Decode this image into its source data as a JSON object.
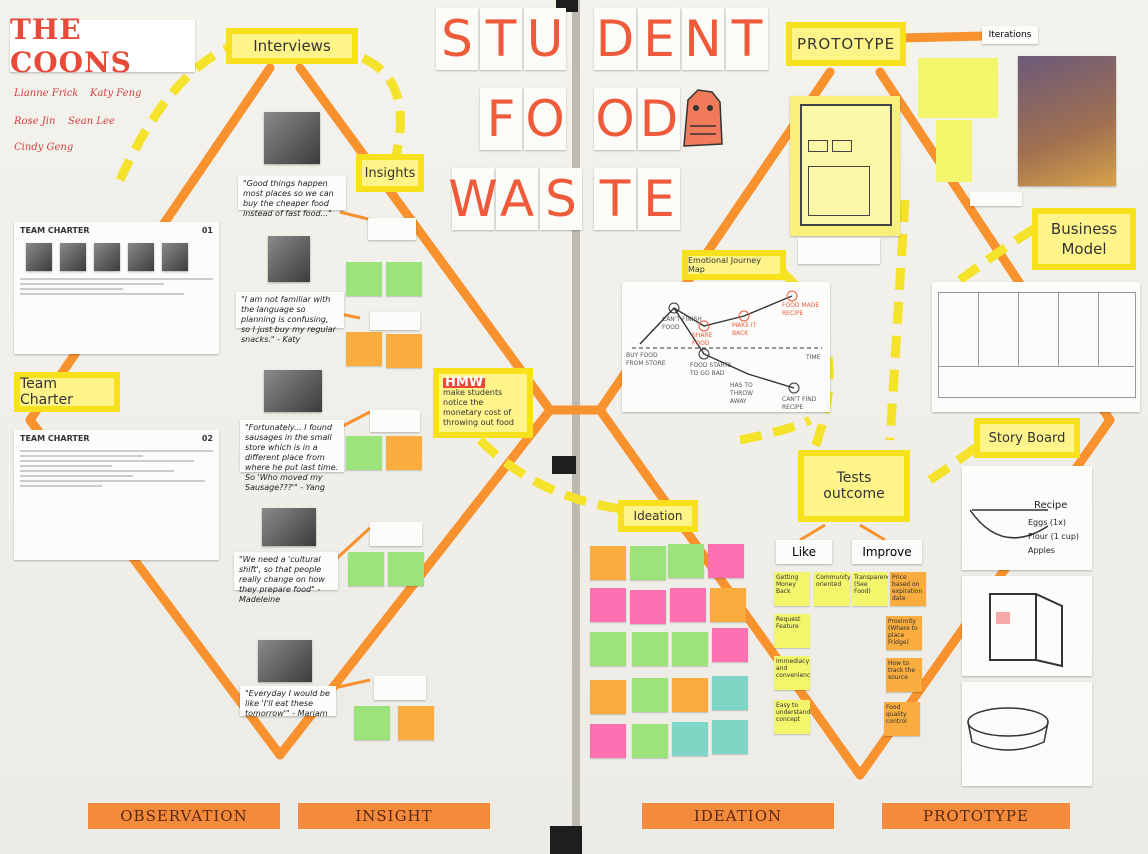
{
  "team": {
    "logo_text": "THE COONS",
    "members": [
      "Lianne Frick",
      "Katy Feng",
      "Rose Jin",
      "Sean Lee",
      "Cindy Geng"
    ]
  },
  "title": {
    "line1": [
      "S",
      "T",
      "U",
      "D",
      "E",
      "N",
      "T"
    ],
    "line2": [
      "F",
      "O",
      "O",
      "D"
    ],
    "line3": [
      "W",
      "A",
      "S",
      "T",
      "E"
    ]
  },
  "labels": {
    "interviews": "Interviews",
    "insights": "Insights",
    "team_charter": "Team Charter",
    "hmw": "HMW",
    "hmw_rest": "make students notice the monetary cost of throwing out food",
    "prototype": "PROTOTYPE",
    "iterations": "Iterations",
    "business_model": "Business Model",
    "emotional_journey_map": "Emotional Journey Map",
    "tests_outcome": "Tests outcome",
    "like": "Like",
    "improve": "Improve",
    "story_board": "Story Board",
    "ideation": "Ideation"
  },
  "team_charter_cards": [
    {
      "title": "TEAM CHARTER",
      "number": "01"
    },
    {
      "title": "TEAM CHARTER",
      "number": "02"
    }
  ],
  "quotes": [
    "\"Good things happen most places so we can buy the cheaper food instead of fast food...\"",
    "\"I am not familiar with the language so planning is confusing, so I just buy my regular snacks.\" - Katy",
    "\"Fortunately... I found sausages in the small store which is in a different place from where he put last time. So 'Who moved my Sausage???'\" - Yang",
    "\"We need a 'cultural shift', so that people really change on how they prepare food\" - Madeleine",
    "\"Everyday I would be like 'I'll eat these tomorrow'\" - Mariam"
  ],
  "journey": {
    "points": [
      "BUY FOOD FROM STORE",
      "CAN'T FINISH FOOD",
      "SHARE FOOD",
      "MAKE IT BACK",
      "FOOD MADE RECIPE",
      "FOOD STARTS TO GO BAD",
      "HAS TO THROW AWAY",
      "CAN'T FIND RECIPE"
    ],
    "axis": "TIME"
  },
  "tests_like": [
    "Getting Money Back",
    "Community oriented",
    "Request Feature",
    "Immediacy and convenience",
    "Easy to understand concept"
  ],
  "tests_improve": [
    "Transparency (See Food)",
    "Price based on expiration date",
    "Proximity (Where to place Fridge)",
    "How to track the source",
    "Food quality control"
  ],
  "storyboard": [
    "Recipe",
    "Eggs (1x)",
    "Flour (1 cup)",
    "Apples"
  ],
  "stages": [
    "OBSERVATION",
    "INSIGHT",
    "IDEATION",
    "PROTOTYPE"
  ],
  "colors": {
    "orange_tape": "#f7922f",
    "yellow_tape": "#f4e32a",
    "title_red": "#ee5a3a",
    "sticky_yellow": "#f3f56b",
    "sticky_pink": "#ff70b3",
    "sticky_green": "#9be37a",
    "sticky_orange": "#f8ad3e",
    "sticky_teal": "#7fd6c5"
  }
}
